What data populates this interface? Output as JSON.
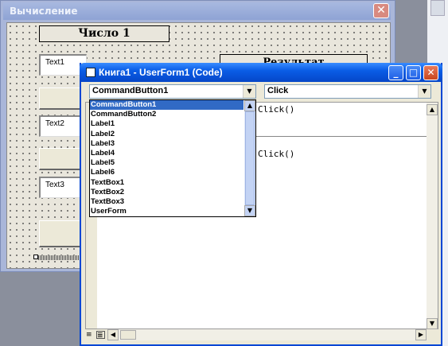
{
  "userform": {
    "title": "Вычисление",
    "close_glyph": "✕",
    "label1": "Число 1",
    "label_result": "Результат",
    "textboxes": [
      "Text1",
      "Text2",
      "Text3"
    ]
  },
  "code_window": {
    "title": "Книга1 - UserForm1 (Code)",
    "object_combo": "CommandButton1",
    "proc_combo": "Click",
    "minimize": "_",
    "maximize": "□",
    "close": "✕",
    "code_lines": [
      "Click()",
      "Click()"
    ]
  },
  "object_list": {
    "selected_index": 0,
    "items": [
      "CommandButton1",
      "CommandButton2",
      "Label1",
      "Label2",
      "Label3",
      "Label4",
      "Label5",
      "Label6",
      "TextBox1",
      "TextBox2",
      "TextBox3",
      "UserForm"
    ]
  },
  "icons": [
    "close-icon",
    "dropdown-arrow-icon",
    "scroll-up-icon",
    "scroll-down-icon",
    "scroll-left-icon",
    "scroll-right-icon",
    "procedure-view-icon",
    "full-module-view-icon"
  ]
}
